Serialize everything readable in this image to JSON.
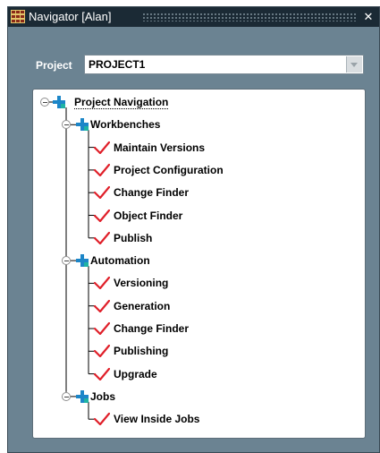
{
  "window": {
    "title": "Navigator [Alan]",
    "close_glyph": "✕"
  },
  "project": {
    "label": "Project",
    "selected": "PROJECT1"
  },
  "tree": {
    "root": "Project Navigation",
    "groups": [
      {
        "label": "Workbenches",
        "items": [
          "Maintain Versions",
          "Project Configuration",
          "Change Finder",
          "Object Finder",
          "Publish"
        ]
      },
      {
        "label": "Automation",
        "items": [
          "Versioning",
          "Generation",
          "Change Finder",
          "Publishing",
          "Upgrade"
        ]
      },
      {
        "label": "Jobs",
        "items": [
          "View Inside Jobs"
        ]
      }
    ]
  },
  "icons": {
    "app": "grid-icon",
    "group": "cross-icon",
    "item": "check-icon",
    "expander": "collapse-icon"
  },
  "colors": {
    "window_bg": "#6b8392",
    "titlebar_bg": "#1b2a35",
    "cross_blue": "#1c86c8",
    "cross_teal": "#1fb3a4",
    "check_red": "#e0202a"
  }
}
